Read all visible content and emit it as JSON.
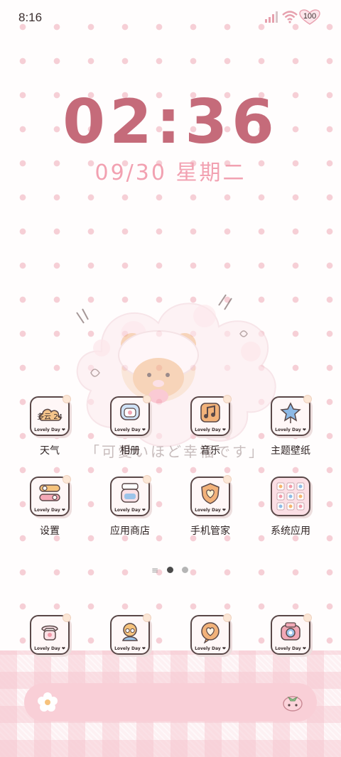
{
  "status_bar": {
    "time": "8:16",
    "battery": "100",
    "icons": [
      "signal-icon",
      "wifi-icon",
      "battery-icon"
    ]
  },
  "lock_widget": {
    "clock": "02:36",
    "date": "09/30  星期二"
  },
  "wallpaper": {
    "slogan": "「可愛いほど幸福です」"
  },
  "apps_row1": [
    {
      "label": "天气",
      "icon": "weather-cloud-icon",
      "badge": "多云 24",
      "tag": "Lovely Day ❤"
    },
    {
      "label": "相册",
      "icon": "album-icon",
      "tag": "Lovely Day ❤"
    },
    {
      "label": "音乐",
      "icon": "music-note-icon",
      "tag": "Lovely Day ❤"
    },
    {
      "label": "主题壁纸",
      "icon": "theme-balloon-icon",
      "tag": "Lovely Day ❤"
    }
  ],
  "apps_row2": [
    {
      "label": "设置",
      "icon": "settings-toggle-icon",
      "tag": "Lovely Day ❤"
    },
    {
      "label": "应用商店",
      "icon": "app-store-jar-icon",
      "tag": "Lovely Day ❤"
    },
    {
      "label": "手机管家",
      "icon": "phone-manager-shield-icon",
      "tag": "Lovely Day ❤"
    },
    {
      "label": "系统应用",
      "icon": "system-apps-folder-icon"
    }
  ],
  "dock": [
    {
      "icon": "phone-icon",
      "tag": "Lovely Day ❤"
    },
    {
      "icon": "contacts-icon",
      "tag": "Lovely Day ❤"
    },
    {
      "icon": "messages-heart-icon",
      "tag": "Lovely Day ❤"
    },
    {
      "icon": "camera-icon",
      "tag": "Lovely Day ❤"
    }
  ],
  "colors": {
    "clock": "#c56b7a",
    "date": "#f2a1b1",
    "search_bar": "#f9cfd7"
  }
}
